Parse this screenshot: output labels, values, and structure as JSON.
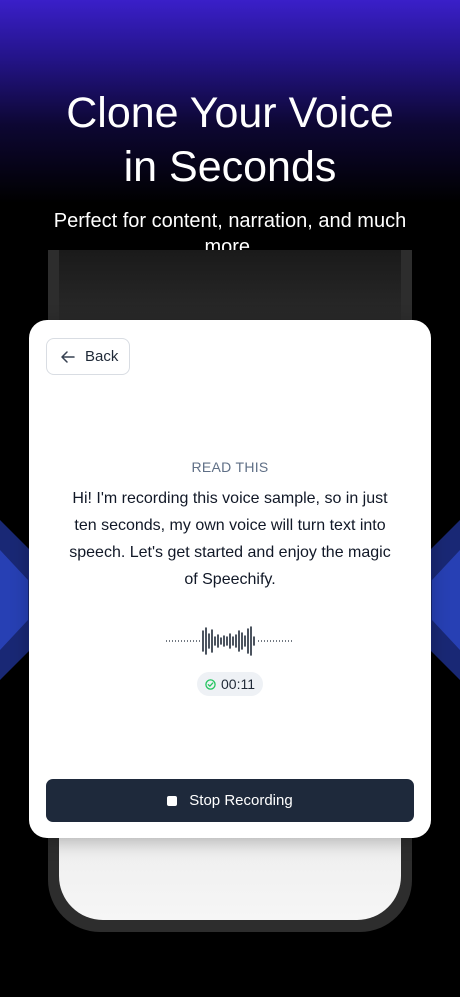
{
  "hero": {
    "title_line1": "Clone Your Voice",
    "title_line2": "in Seconds",
    "subtitle": "Perfect for content, narration, and much more."
  },
  "card": {
    "back_label": "Back",
    "section_label": "READ THIS",
    "prompt_text": "Hi! I'm recording this voice sample, so in just ten seconds, my own voice will turn text into speech. Let's get started and enjoy the magic of Speechify.",
    "timer": "00:11",
    "stop_label": "Stop Recording"
  },
  "icons": {
    "back": "arrow-left-icon",
    "timer_status": "check-circle-icon",
    "stop": "stop-square-icon"
  },
  "colors": {
    "accent_purple": "#3a1fc9",
    "button_dark": "#1e293b",
    "success_green": "#22c55e",
    "label_slate": "#5f6f86"
  }
}
